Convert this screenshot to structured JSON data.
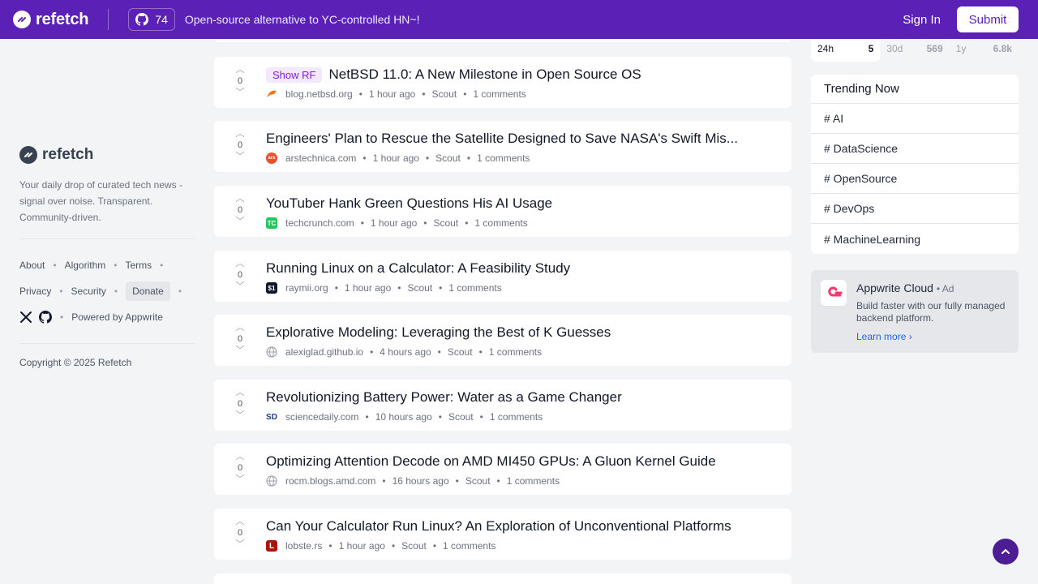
{
  "header": {
    "brand": "refetch",
    "github_stars": "74",
    "tagline": "Open-source alternative to YC-controlled HN~!",
    "signin": "Sign In",
    "submit": "Submit"
  },
  "sidebar": {
    "brand": "refetch",
    "description": "Your daily drop of curated tech news - signal over noise. Transparent. Community-driven.",
    "links_row1": [
      "About",
      "Algorithm",
      "Terms"
    ],
    "links_row2": [
      "Privacy",
      "Security",
      "Donate"
    ],
    "powered_by": "Powered by Appwrite",
    "copyright": "Copyright © 2025 Refetch"
  },
  "feed": [
    {
      "badge": "Show RF",
      "title": "NetBSD 11.0: A New Milestone in Open Source OS",
      "domain": "blog.netbsd.org",
      "time": "1 hour ago",
      "author": "Scout",
      "comments": "1 comments",
      "votes": "0",
      "icon": "netbsd-icon",
      "icon_color": "#f97316"
    },
    {
      "badge": "",
      "title": "Engineers' Plan to Rescue the Satellite Designed to Save NASA's Swift Mis...",
      "domain": "arstechnica.com",
      "time": "1 hour ago",
      "author": "Scout",
      "comments": "1 comments",
      "votes": "0",
      "icon": "ars-icon",
      "icon_color": "#e8512a"
    },
    {
      "badge": "",
      "title": "YouTuber Hank Green Questions His AI Usage",
      "domain": "techcrunch.com",
      "time": "1 hour ago",
      "author": "Scout",
      "comments": "1 comments",
      "votes": "0",
      "icon": "techcrunch-icon",
      "icon_color": "#22c55e"
    },
    {
      "badge": "",
      "title": "Running Linux on a Calculator: A Feasibility Study",
      "domain": "raymii.org",
      "time": "1 hour ago",
      "author": "Scout",
      "comments": "1 comments",
      "votes": "0",
      "icon": "raymii-icon",
      "icon_color": "#111827"
    },
    {
      "badge": "",
      "title": "Explorative Modeling: Leveraging the Best of K Guesses",
      "domain": "alexiglad.github.io",
      "time": "4 hours ago",
      "author": "Scout",
      "comments": "1 comments",
      "votes": "0",
      "icon": "globe-icon",
      "icon_color": "#9ca3af"
    },
    {
      "badge": "",
      "title": "Revolutionizing Battery Power: Water as a Game Changer",
      "domain": "sciencedaily.com",
      "time": "10 hours ago",
      "author": "Scout",
      "comments": "1 comments",
      "votes": "0",
      "icon": "sciencedaily-icon",
      "icon_color": "#1e3a8a"
    },
    {
      "badge": "",
      "title": "Optimizing Attention Decode on AMD MI450 GPUs: A Gluon Kernel Guide",
      "domain": "rocm.blogs.amd.com",
      "time": "16 hours ago",
      "author": "Scout",
      "comments": "1 comments",
      "votes": "0",
      "icon": "globe-icon",
      "icon_color": "#9ca3af"
    },
    {
      "badge": "",
      "title": "Can Your Calculator Run Linux? An Exploration of Unconventional Platforms",
      "domain": "lobste.rs",
      "time": "1 hour ago",
      "author": "Scout",
      "comments": "1 comments",
      "votes": "0",
      "icon": "lobsters-icon",
      "icon_color": "#ac130d"
    }
  ],
  "stats": [
    {
      "label": "24h",
      "value": "5"
    },
    {
      "label": "30d",
      "value": "569"
    },
    {
      "label": "1y",
      "value": "6.8k"
    }
  ],
  "trending": {
    "title": "Trending Now",
    "items": [
      "# AI",
      "# DataScience",
      "# OpenSource",
      "# DevOps",
      "# MachineLearning"
    ]
  },
  "ad": {
    "title": "Appwrite Cloud",
    "tag": "Ad",
    "description": "Build faster with our fully managed backend platform.",
    "link": "Learn more"
  },
  "colors": {
    "brand": "#5b21b6",
    "accent": "#7e22ce"
  }
}
